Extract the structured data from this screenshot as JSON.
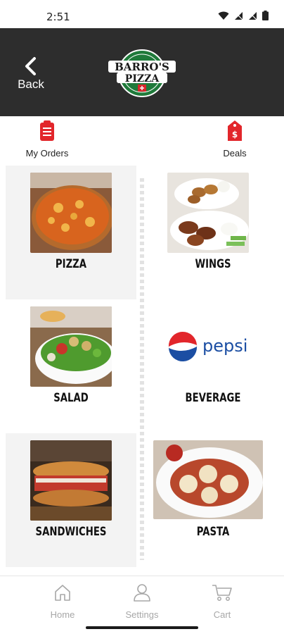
{
  "status_bar": {
    "time": "2:51"
  },
  "header": {
    "back_label": "Back",
    "logo_text": "BARRO'S PIZZA"
  },
  "quick_actions": {
    "orders_label": "My Orders",
    "deals_label": "Deals"
  },
  "menu": {
    "items": [
      {
        "label": "PIZZA"
      },
      {
        "label": "WINGS"
      },
      {
        "label": "SALAD"
      },
      {
        "label": "BEVERAGE"
      },
      {
        "label": "SANDWICHES"
      },
      {
        "label": "PASTA"
      }
    ],
    "pepsi_text": "pepsi"
  },
  "bottom_nav": {
    "home_label": "Home",
    "settings_label": "Settings",
    "cart_label": "Cart"
  },
  "colors": {
    "header_bg": "#2d2d2d",
    "accent_red": "#e2262b",
    "nav_gray": "#a7a7a7"
  }
}
